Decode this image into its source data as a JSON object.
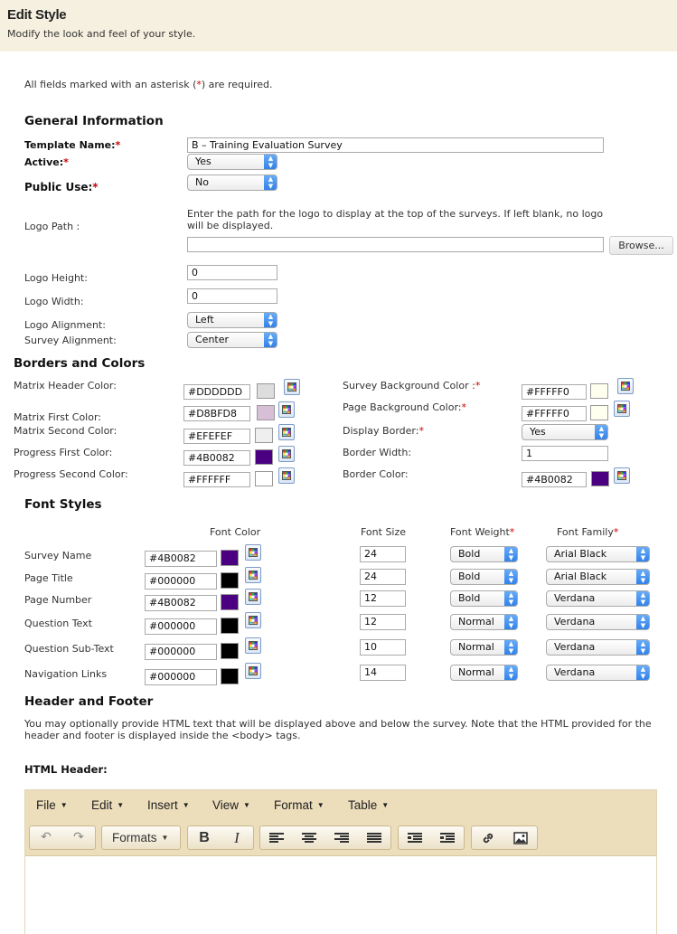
{
  "header": {
    "title": "Edit Style",
    "subtitle": "Modify the look and feel of your style."
  },
  "required_note": {
    "before": "All fields marked with an asterisk (",
    "star": "*",
    "after": ") are required."
  },
  "general": {
    "heading": "General Information",
    "template_name": {
      "label": "Template Name:",
      "value": "B – Training Evaluation Survey"
    },
    "active": {
      "label": "Active:",
      "value": "Yes"
    },
    "public_use": {
      "label": "Public Use:",
      "value": "No"
    },
    "logo_path": {
      "label": "Logo Path :",
      "help": "Enter the path for the logo to display at the top of the surveys. If left blank, no logo will be displayed.",
      "value": "",
      "browse": "Browse..."
    },
    "logo_height": {
      "label": "Logo Height:",
      "value": "0"
    },
    "logo_width": {
      "label": "Logo Width:",
      "value": "0"
    },
    "logo_alignment": {
      "label": "Logo Alignment:",
      "value": "Left"
    },
    "survey_alignment": {
      "label": "Survey Alignment:",
      "value": "Center"
    }
  },
  "borders": {
    "heading": "Borders and Colors",
    "matrix_header": {
      "label": "Matrix Header Color:",
      "value": "#DDDDDD",
      "swatch": "#DDDDDD"
    },
    "matrix_first": {
      "label": "Matrix First Color:",
      "value": "#D8BFD8",
      "swatch": "#D8BFD8"
    },
    "matrix_second": {
      "label": "Matrix Second Color:",
      "value": "#EFEFEF",
      "swatch": "#EFEFEF"
    },
    "progress_first": {
      "label": "Progress First Color:",
      "value": "#4B0082",
      "swatch": "#4B0082"
    },
    "progress_second": {
      "label": "Progress Second Color:",
      "value": "#FFFFFF",
      "swatch": "#FFFFFF"
    },
    "survey_bg": {
      "label": "Survey Background Color :",
      "value": "#FFFFF0",
      "swatch": "#FFFFF0"
    },
    "page_bg": {
      "label": "Page Background Color:",
      "value": "#FFFFF0",
      "swatch": "#FFFFF0"
    },
    "display_border": {
      "label": "Display Border:",
      "value": "Yes"
    },
    "border_width": {
      "label": "Border Width:",
      "value": "1"
    },
    "border_color": {
      "label": "Border Color:",
      "value": "#4B0082",
      "swatch": "#4B0082"
    }
  },
  "fonts": {
    "heading": "Font Styles",
    "col_font_color": "Font Color",
    "col_font_size": "Font Size",
    "col_font_weight": "Font Weight",
    "col_font_family": "Font Family",
    "rows": [
      {
        "label": "Survey Name",
        "color": "#4B0082",
        "swatch": "#4B0082",
        "size": "24",
        "weight": "Bold",
        "family": "Arial Black"
      },
      {
        "label": "Page Title",
        "color": "#000000",
        "swatch": "#000000",
        "size": "24",
        "weight": "Bold",
        "family": "Arial Black"
      },
      {
        "label": "Page Number",
        "color": "#4B0082",
        "swatch": "#4B0082",
        "size": "12",
        "weight": "Bold",
        "family": "Verdana"
      },
      {
        "label": "Question Text",
        "color": "#000000",
        "swatch": "#000000",
        "size": "12",
        "weight": "Normal",
        "family": "Verdana"
      },
      {
        "label": "Question Sub-Text",
        "color": "#000000",
        "swatch": "#000000",
        "size": "10",
        "weight": "Normal",
        "family": "Verdana"
      },
      {
        "label": "Navigation Links",
        "color": "#000000",
        "swatch": "#000000",
        "size": "14",
        "weight": "Normal",
        "family": "Verdana"
      }
    ]
  },
  "header_footer": {
    "heading": "Header and Footer",
    "help": "You may optionally provide HTML text that will be displayed above and below the survey. Note that the HTML provided for the header and footer is displayed inside the <body> tags.",
    "html_header_label": "HTML Header:"
  },
  "editor": {
    "menus": [
      "File",
      "Edit",
      "Insert",
      "View",
      "Format",
      "Table"
    ],
    "formats_label": "Formats",
    "bold": "B",
    "italic": "I"
  }
}
